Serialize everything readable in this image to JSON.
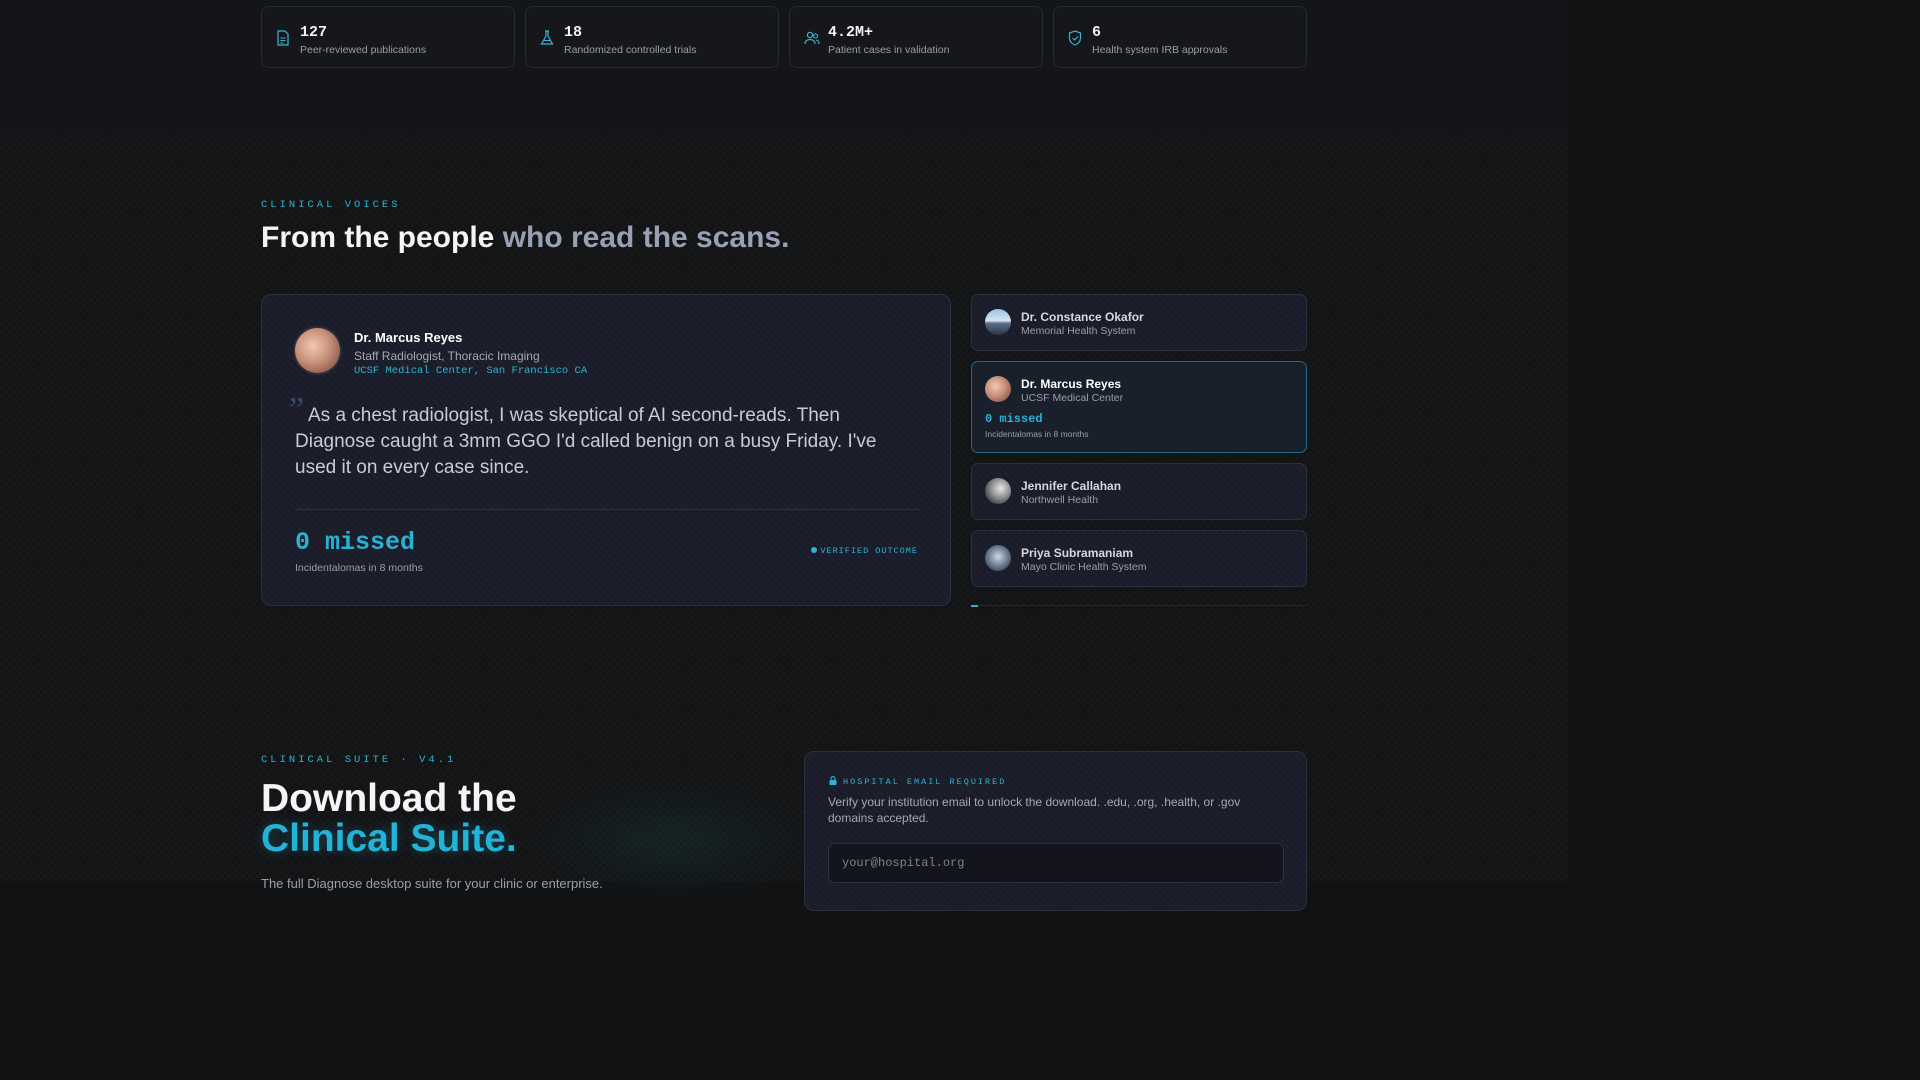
{
  "stats": [
    {
      "icon": "document-icon",
      "value": "127",
      "label": "Peer-reviewed publications"
    },
    {
      "icon": "flask-icon",
      "value": "18",
      "label": "Randomized controlled trials"
    },
    {
      "icon": "users-icon",
      "value": "4.2M+",
      "label": "Patient cases in validation"
    },
    {
      "icon": "shield-check-icon",
      "value": "6",
      "label": "Health system IRB approvals"
    }
  ],
  "voices": {
    "eyebrow": "CLINICAL VOICES",
    "heading_main": "From the people ",
    "heading_muted": "who read the scans.",
    "featured": {
      "name": "Dr. Marcus Reyes",
      "role": "Staff Radiologist, Thoracic Imaging",
      "org": "UCSF Medical Center, San Francisco CA",
      "quote_mark": "”",
      "quote": "As a chest radiologist, I was skeptical of AI second-reads. Then Diagnose caught a 3mm GGO I'd called benign on a busy Friday. I've used it on every case since.",
      "metric": "0 missed",
      "metric_label": "Incidentalomas in 8 months",
      "badge": "VERIFIED OUTCOME"
    },
    "list": [
      {
        "name": "Dr. Constance Okafor",
        "org": "Memorial Health System"
      },
      {
        "name": "Dr. Marcus Reyes",
        "org": "UCSF Medical Center",
        "metric": "0 missed",
        "metric_label": "Incidentalomas in 8 months"
      },
      {
        "name": "Jennifer Callahan",
        "org": "Northwell Health"
      },
      {
        "name": "Priya Subramaniam",
        "org": "Mayo Clinic Health System"
      }
    ],
    "rotation_progress": 0.02
  },
  "download": {
    "eyebrow": "CLINICAL SUITE · V4.1",
    "heading_line1": "Download the",
    "heading_line2": "Clinical Suite.",
    "body_cut": "The full Diagnose desktop suite for your clinic or enterprise.",
    "card_label": "HOSPITAL EMAIL REQUIRED",
    "card_text": "Verify your institution email to unlock the download. .edu, .org, .health, or .gov domains accepted.",
    "email_placeholder": "your@hospital.org"
  },
  "colors": {
    "accent": "#2fb3d3",
    "background": "#121315"
  }
}
